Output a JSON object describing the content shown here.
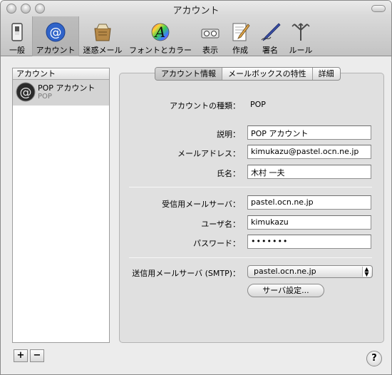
{
  "window": {
    "title": "アカウント"
  },
  "toolbar": {
    "items": [
      {
        "label": "一般",
        "icon": "switch-icon"
      },
      {
        "label": "アカウント",
        "icon": "at-sign-icon",
        "selected": true
      },
      {
        "label": "迷惑メール",
        "icon": "junk-mail-icon"
      },
      {
        "label": "フォントとカラー",
        "icon": "font-color-icon"
      },
      {
        "label": "表示",
        "icon": "viewing-icon"
      },
      {
        "label": "作成",
        "icon": "compose-icon"
      },
      {
        "label": "署名",
        "icon": "signature-pen-icon"
      },
      {
        "label": "ルール",
        "icon": "rules-icon"
      }
    ]
  },
  "accounts": {
    "header": "アカウント",
    "items": [
      {
        "name": "POP アカウント",
        "type": "POP"
      }
    ]
  },
  "tabs": [
    "アカウント情報",
    "メールボックスの特性",
    "詳細"
  ],
  "form": {
    "account_type_label": "アカウントの種類：",
    "account_type_value": "POP",
    "description_label": "説明：",
    "description_value": "POP アカウント",
    "email_label": "メールアドレス：",
    "email_value": "kimukazu@pastel.ocn.ne.jp",
    "fullname_label": "氏名：",
    "fullname_value": "木村 一夫",
    "incoming_label": "受信用メールサーバ：",
    "incoming_value": "pastel.ocn.ne.jp",
    "username_label": "ユーザ名：",
    "username_value": "kimukazu",
    "password_label": "パスワード：",
    "password_value": "•••••••",
    "smtp_label": "送信用メールサーバ (SMTP)：",
    "smtp_value": "pastel.ocn.ne.jp",
    "server_settings_button": "サーバ設定..."
  },
  "buttons": {
    "add": "+",
    "remove": "−",
    "help": "?"
  }
}
